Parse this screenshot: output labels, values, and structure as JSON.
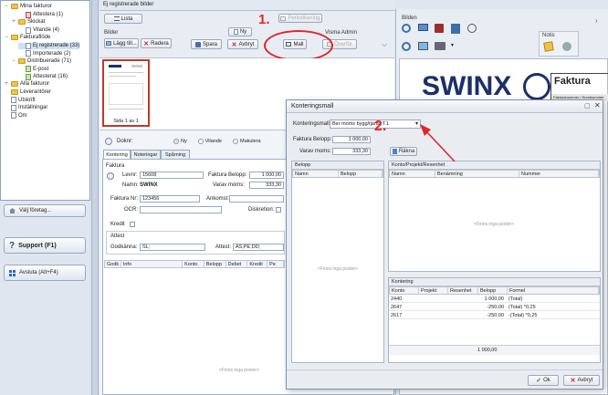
{
  "sidebar": {
    "items": [
      {
        "label": "Mina fakturor",
        "level": 0,
        "exp": "−"
      },
      {
        "label": "Attestera (1)",
        "level": 2
      },
      {
        "label": "Skickat",
        "level": 1,
        "exp": "+"
      },
      {
        "label": "Vilande (4)",
        "level": 2
      },
      {
        "label": "Fakturaflöde",
        "level": 0,
        "exp": "−"
      },
      {
        "label": "Ej registrerade (33)",
        "level": 2
      },
      {
        "label": "Importerade (2)",
        "level": 2
      },
      {
        "label": "Distribuerade (71)",
        "level": 1,
        "exp": "−"
      },
      {
        "label": "E-post",
        "level": 2
      },
      {
        "label": "Attesterat (16)",
        "level": 2
      },
      {
        "label": "Alla fakturor",
        "level": 0,
        "exp": "+"
      },
      {
        "label": "Leverantörer",
        "level": 0
      },
      {
        "label": "Utskrift",
        "level": 0
      },
      {
        "label": "Inställningar",
        "level": 0
      },
      {
        "label": "Om",
        "level": 0
      }
    ],
    "buttons": {
      "valj_foretag": "Välj företag...",
      "support": "Support (F1)",
      "avsluta": "Avsluta (Alt+F4)"
    }
  },
  "main": {
    "title": "Ej registrerade bilder",
    "lista": "Lista",
    "bilder_group": "Bilder",
    "lagg_till": "Lägg till...",
    "radera": "Radera",
    "ny": "Ny",
    "spara": "Spara",
    "avbryt": "Avbryt",
    "periodisering": "Periodisering",
    "mall": "Mall",
    "visma_admin": "Visma Admin",
    "overfor": "Överför",
    "thumb_label": "Sida 1 av 1",
    "annotation_1": "1.",
    "annotation_2": "2."
  },
  "form": {
    "doknr_label": "Doknr:",
    "radio_ny": "Ny",
    "radio_vilande": "Vilande",
    "radio_makulera": "Makulera",
    "tabs": [
      "Kontering",
      "Noteringar",
      "Spårning"
    ],
    "faktura_group": "Faktura",
    "levnr_label": "Levnr:",
    "levnr_value": "15608",
    "namn_label": "Namn:",
    "namn_value": "SWINX",
    "faktura_belopp_label": "Faktura Belopp:",
    "faktura_belopp_value": "1 000,00",
    "varav_moms_label": "Varav moms:",
    "varav_moms_value": "333,30",
    "faktura_nr_label": "Faktura Nr:",
    "faktura_nr_value": "123456",
    "ankomst_label": "Ankomst:",
    "ocr_label": "OCR:",
    "diskretion_label": "Diskretion:",
    "kredit_label": "Kredit",
    "attest_group": "Attest",
    "godkanna_label": "Godkänna:",
    "godkanna_value": "SL;",
    "attest_label": "Attest:",
    "attest_value": "AS;PE;DD;",
    "grid_columns": [
      "Godk",
      "Info",
      "Konto",
      "Belopp",
      "Debet",
      "Kredit",
      "Pe"
    ],
    "empty_text": "<Finns inga poster>"
  },
  "right": {
    "bilden_group": "Bilden",
    "notis_group": "Notis",
    "logo_text": "SWINX",
    "faktura_title": "Faktura",
    "faktura_sub": "Fakturanummer / Kundnummer"
  },
  "modal": {
    "title": "Konteringsmall",
    "konteringsmall_label": "Konteringsmall:",
    "konteringsmall_value": "Ber moms bygg/tjänst T.1",
    "faktura_belopp_label": "Faktura Belopp:",
    "faktura_belopp_value": "1 000,00",
    "varav_moms_label": "Varav moms:",
    "varav_moms_value": "333,30",
    "rakna": "Räkna",
    "belopp_panel": "Belopp",
    "belopp_cols": [
      "Namn",
      "Belopp"
    ],
    "kpr_panel": "Konto/Projekt/Resenhet",
    "kpr_cols": [
      "Namn",
      "Benämning",
      "Nummer"
    ],
    "empty_text": "<Finns inga poster>",
    "kontering_panel": "Kontering",
    "kontering_cols": [
      "Konto",
      "Projekt",
      "Resenhet",
      "Belopp",
      "Formel"
    ],
    "kontering_rows": [
      [
        "2440",
        "",
        "",
        "1 000,00",
        "(Total)"
      ],
      [
        "2647",
        "",
        "",
        "-250,00",
        "(Total) *0,25"
      ],
      [
        "2617",
        "",
        "",
        "-250,00",
        "-(Total) *0,25"
      ]
    ],
    "kontering_total": "1 000,00",
    "ok": "Ok",
    "avbryt": "Avbryt"
  },
  "colors": {
    "accent_red": "#e0262a",
    "logo_navy": "#1b2f6b",
    "header_bg": "#e3e9f0"
  }
}
